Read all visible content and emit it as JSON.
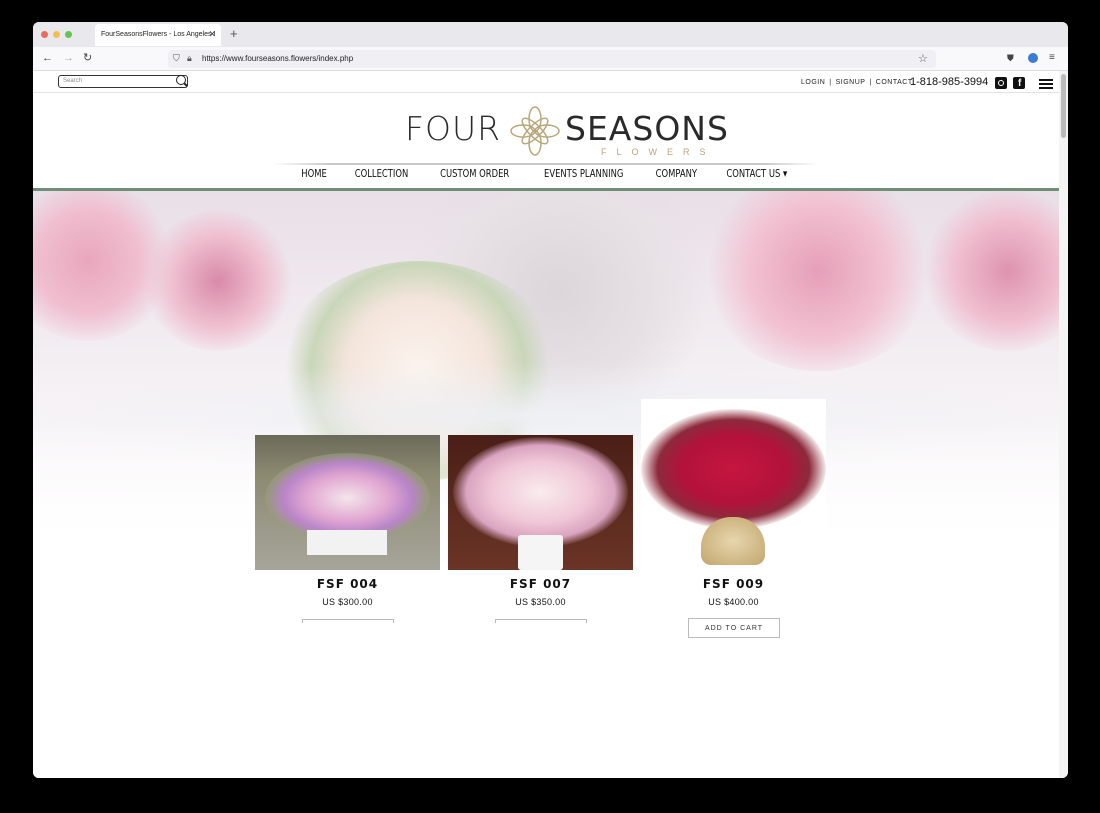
{
  "browser": {
    "tab_title": "FourSeasonsFlowers - Los Angeles I",
    "url": "https://www.fourseasons.flowers/index.php"
  },
  "topbar": {
    "search_placeholder": "Search",
    "links": [
      "LOGIN",
      "SIGNUP",
      "CONTACT"
    ],
    "separator": "|",
    "phone": "1-818-985-3994"
  },
  "logo": {
    "word1": "FOUR",
    "word2": "SEASONS",
    "tagline": "FLOWERS"
  },
  "nav": {
    "items": [
      "HOME",
      "COLLECTION",
      "CUSTOM ORDER",
      "EVENTS PLANNING",
      "COMPANY",
      "CONTACT US ▾"
    ]
  },
  "products": [
    {
      "name": "FSF 004",
      "price": "US $300.00",
      "button": ""
    },
    {
      "name": "FSF 007",
      "price": "US $350.00",
      "button": ""
    },
    {
      "name": "FSF 009",
      "price": "US $400.00",
      "button": "ADD TO CART"
    }
  ],
  "colors": {
    "accent_green": "#6f8e78",
    "logo_gold": "#b9a77a"
  }
}
